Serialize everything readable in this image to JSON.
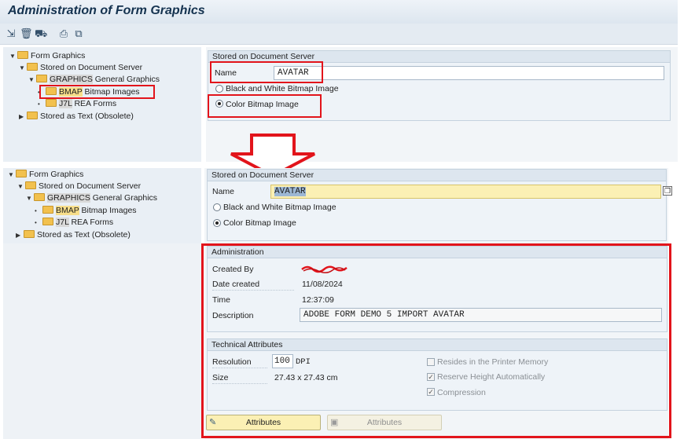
{
  "title": "Administration of Form Graphics",
  "toolbar": {
    "icons": [
      "import-icon",
      "delete-icon",
      "transport-icon",
      "print-icon",
      "copy-icon"
    ]
  },
  "tree_top": {
    "root": "Form Graphics",
    "doc_server": "Stored on Document Server",
    "graphics_key": "GRAPHICS",
    "graphics_label": "General Graphics",
    "bmap_key": "BMAP",
    "bmap_label": "Bitmap Images",
    "j7l_key": "J7L",
    "j7l_label": "REA Forms",
    "text": "Stored as Text (Obsolete)"
  },
  "top_panel": {
    "group": "Stored on Document Server",
    "name_label": "Name",
    "name_value": "AVATAR",
    "bw_label": "Black and White Bitmap Image",
    "color_label": "Color Bitmap Image"
  },
  "tree_bottom": {
    "root": "Form Graphics",
    "doc_server": "Stored on Document Server",
    "graphics_key": "GRAPHICS",
    "graphics_label": "General Graphics",
    "bmap_key": "BMAP",
    "bmap_label": "Bitmap Images",
    "j7l_key": "J7L",
    "j7l_label": "REA Forms",
    "text": "Stored as Text (Obsolete)"
  },
  "bottom_panel": {
    "group": "Stored on Document Server",
    "name_label": "Name",
    "name_value": "AVATAR",
    "bw_label": "Black and White Bitmap Image",
    "color_label": "Color Bitmap Image"
  },
  "admin": {
    "group": "Administration",
    "created_by_label": "Created By",
    "date_label": "Date created",
    "date_value": "11/08/2024",
    "time_label": "Time",
    "time_value": "12:37:09",
    "desc_label": "Description",
    "desc_value": "ADOBE FORM DEMO 5 IMPORT AVATAR"
  },
  "tech": {
    "group": "Technical Attributes",
    "res_label": "Resolution",
    "res_value": "100",
    "res_unit": "DPI",
    "size_label": "Size",
    "size_value": "27.43 x 27.43 cm",
    "printer_label": "Resides in the Printer Memory",
    "reserve_label": "Reserve Height Automatically",
    "compression_label": "Compression"
  },
  "buttons": {
    "attributes_edit": "Attributes",
    "attributes_save": "Attributes"
  },
  "colors": {
    "highlight_red": "#e2141b",
    "folder": "#f2c14e",
    "button_yellow": "#fbf0b4"
  }
}
